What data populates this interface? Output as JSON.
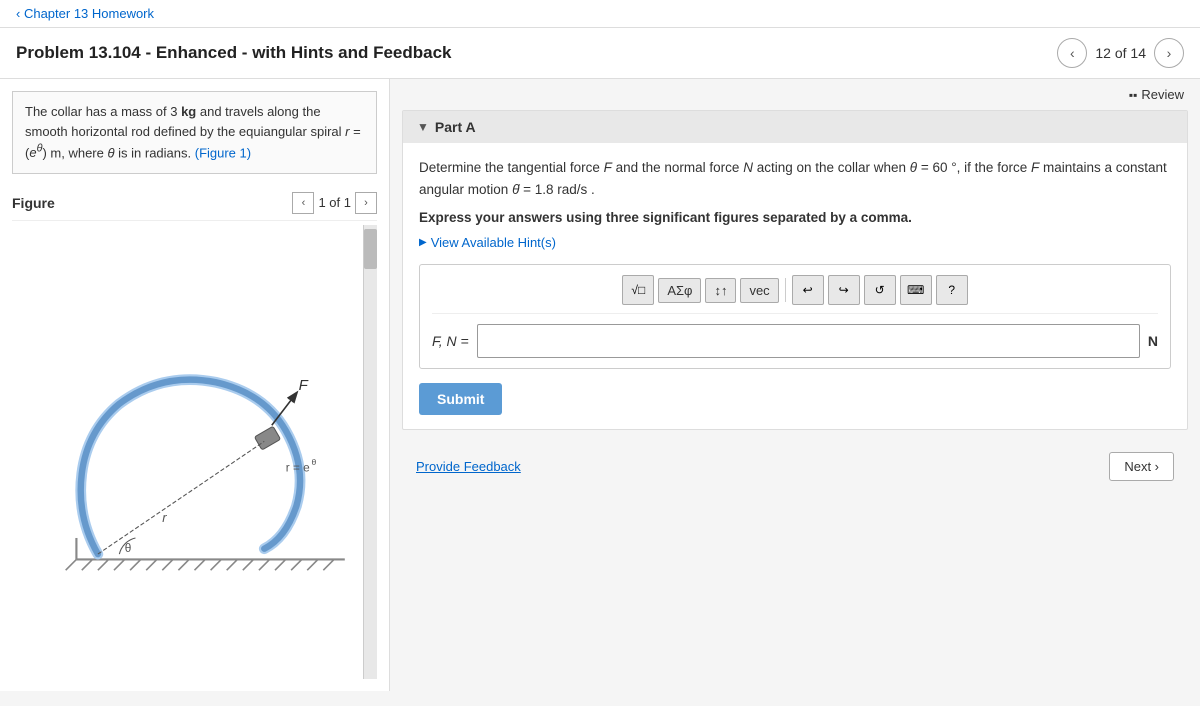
{
  "breadcrumb": {
    "label": "Chapter 13 Homework"
  },
  "header": {
    "title": "Problem 13.104 - Enhanced - with Hints and Feedback",
    "nav_count": "12 of 14",
    "prev_label": "‹",
    "next_label": "›"
  },
  "review": {
    "label": "Review"
  },
  "left_panel": {
    "problem_statement": "The collar has a mass of 3 kg and travels along the smooth horizontal rod defined by the equiangular spiral r = (eθ) m, where θ is in radians. (Figure 1)",
    "figure_label": "Figure",
    "figure_count": "1 of 1"
  },
  "part_a": {
    "header": "Part A",
    "question_line1": "Determine the tangential force F and the normal force N acting on the collar when θ = 60 °, if the force F maintains a constant angular motion θ̇ = 1.8 rad/s .",
    "instruction": "Express your answers using three significant figures separated by a comma.",
    "hints_label": "View Available Hint(s)",
    "input_label": "F, N =",
    "unit_label": "N",
    "submit_label": "Submit",
    "toolbar": {
      "sqrt_label": "√□",
      "alpha_label": "AΣφ",
      "arrows_label": "↕↑",
      "vec_label": "vec",
      "undo_label": "↩",
      "redo_label": "↪",
      "refresh_label": "↺",
      "keyboard_label": "⌨",
      "help_label": "?"
    }
  },
  "footer": {
    "feedback_label": "Provide Feedback",
    "next_label": "Next ›"
  },
  "colors": {
    "accent_blue": "#0066cc",
    "submit_blue": "#5b9bd5",
    "header_bg": "#e8e8e8",
    "border": "#cccccc"
  }
}
